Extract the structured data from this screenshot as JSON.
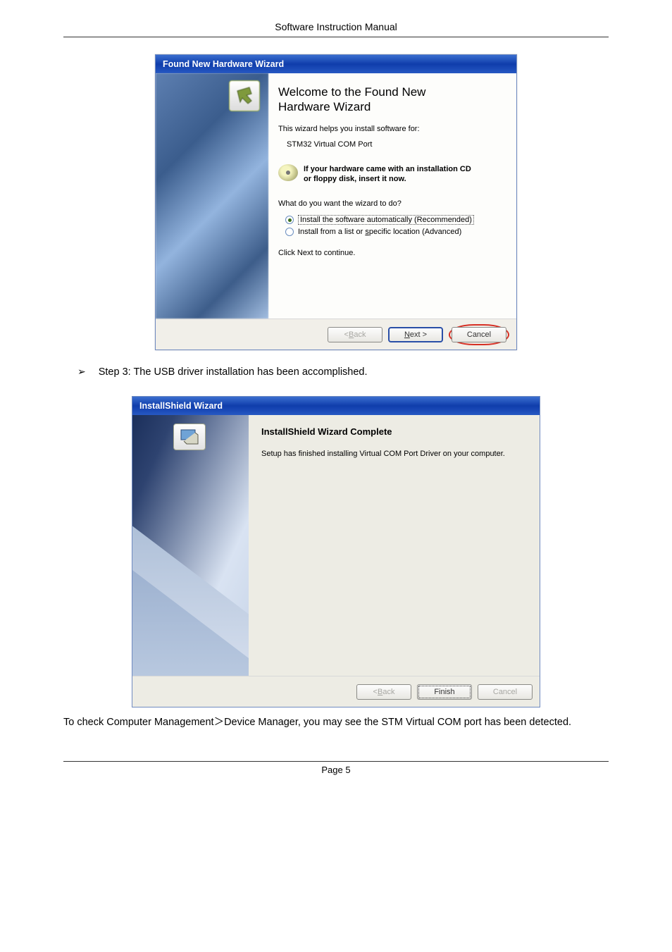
{
  "page": {
    "header": "Software Instruction Manual",
    "footer": "Page 5"
  },
  "dialog1": {
    "title": "Found New Hardware Wizard",
    "heading_line1": "Welcome to the Found New",
    "heading_line2": "Hardware Wizard",
    "intro": "This wizard helps you install software for:",
    "device": "STM32 Virtual COM Port",
    "cd_hint_line1": "If your hardware came with an installation CD",
    "cd_hint_line2": "or floppy disk, insert it now.",
    "prompt": "What do you want the wizard to do?",
    "radio1": "Install the software automatically (Recommended)",
    "radio2_pre": "Install from a list or ",
    "radio2_u": "s",
    "radio2_post": "pecific location (Advanced)",
    "continue": "Click Next to continue.",
    "buttons": {
      "back_pre": "< ",
      "back_u": "B",
      "back_post": "ack",
      "next_u": "N",
      "next_post": "ext >",
      "cancel": "Cancel"
    }
  },
  "step3": {
    "arrow": "➢",
    "text": "Step 3: The USB driver installation has been accomplished."
  },
  "dialog2": {
    "title": "InstallShield Wizard",
    "heading": "InstallShield Wizard Complete",
    "body": "Setup has finished installing Virtual COM Port Driver on your computer.",
    "buttons": {
      "back_pre": "< ",
      "back_u": "B",
      "back_post": "ack",
      "finish": "Finish",
      "cancel": "Cancel"
    }
  },
  "outro": "To check Computer Management＞Device Manager, you may see the STM Virtual COM port has been detected."
}
